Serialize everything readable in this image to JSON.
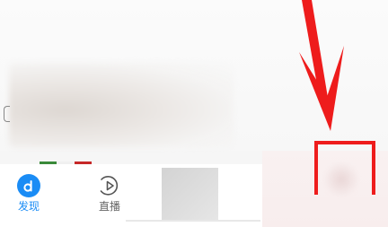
{
  "bottom_nav": {
    "tabs": [
      {
        "label": "发现",
        "icon": "discover-icon",
        "state": "active"
      },
      {
        "label": "直播",
        "icon": "play-circle-icon",
        "state": "inactive"
      }
    ]
  },
  "annotation": {
    "arrow_icon": "red-down-arrow-icon",
    "highlight_box_icon": "red-highlight-box"
  },
  "colors": {
    "accent": "#1a8cf5",
    "annotation": "#ee1c1c",
    "inactive_label": "#666666"
  }
}
